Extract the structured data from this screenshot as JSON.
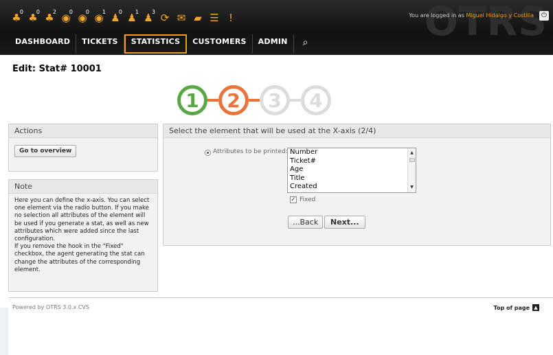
{
  "header": {
    "brand": "OTRS",
    "login_prefix": "You are logged in as",
    "user_name": "Miguel Hidalgo y Costilla",
    "toolbar": [
      {
        "icon": "locked-tickets-new-icon",
        "glyph": "♣",
        "color": "#f2a52a",
        "count": "0"
      },
      {
        "icon": "locked-tickets-reminder-icon",
        "glyph": "♣",
        "color": "#f2a52a",
        "count": "0"
      },
      {
        "icon": "locked-tickets-all-icon",
        "glyph": "♣",
        "color": "#f2a52a",
        "count": "2"
      },
      {
        "icon": "watched-tickets-new-icon",
        "glyph": "◉",
        "color": "#f2a52a",
        "count": "0"
      },
      {
        "icon": "watched-tickets-reminder-icon",
        "glyph": "◉",
        "color": "#f2a52a",
        "count": "0"
      },
      {
        "icon": "watched-tickets-all-icon",
        "glyph": "◉",
        "color": "#f2a52a",
        "count": "1"
      },
      {
        "icon": "responsible-tickets-new-icon",
        "glyph": "♟",
        "color": "#f2a52a",
        "count": "0"
      },
      {
        "icon": "responsible-tickets-reminder-icon",
        "glyph": "♟",
        "color": "#f2a52a",
        "count": "1"
      },
      {
        "icon": "responsible-tickets-all-icon",
        "glyph": "♟",
        "color": "#f2a52a",
        "count": "3"
      },
      {
        "icon": "refresh-icon",
        "glyph": "⟳",
        "color": "#f2a52a",
        "count": ""
      },
      {
        "icon": "new-email-ticket-icon",
        "glyph": "✉",
        "color": "#f2a52a",
        "count": ""
      },
      {
        "icon": "folder-icon",
        "glyph": "▰",
        "color": "#f2a52a",
        "count": ""
      },
      {
        "icon": "list-icon",
        "glyph": "☰",
        "color": "#f2a52a",
        "count": ""
      },
      {
        "icon": "alert-icon",
        "glyph": "!",
        "color": "#f2a52a",
        "count": ""
      }
    ],
    "nav": [
      "DASHBOARD",
      "TICKETS",
      "STATISTICS",
      "CUSTOMERS",
      "ADMIN"
    ],
    "active_nav": "STATISTICS"
  },
  "page": {
    "title": "Edit: Stat# 10001"
  },
  "steps": [
    {
      "label": "1",
      "state": "done"
    },
    {
      "label": "2",
      "state": "current"
    },
    {
      "label": "3",
      "state": "todo"
    },
    {
      "label": "4",
      "state": "todo"
    }
  ],
  "sidebar": {
    "actions_title": "Actions",
    "overview_button": "Go to overview",
    "note_title": "Note",
    "note_text": "Here you can define the x-axis. You can select one element via the radio button. If you make no selection all attributes of the element will be used if you generate a stat, as well as new attributes which were added since the last configuration.\nIf you remove the hook in the \"Fixed\" checkbox, the agent generating the stat can change the attributes of the corresponding element."
  },
  "main": {
    "title": "Select the element that will be used at the X-axis (2/4)",
    "field_label": "Attributes to be printed:",
    "list_items": [
      "Number",
      "Ticket#",
      "Age",
      "Title",
      "Created"
    ],
    "fixed_label": "Fixed",
    "fixed_checked": true,
    "back_button": "...Back",
    "next_button": "Next..."
  },
  "footer": {
    "powered_by": "Powered by OTRS 3.0.x CVS",
    "top_of_page": "Top of page"
  }
}
